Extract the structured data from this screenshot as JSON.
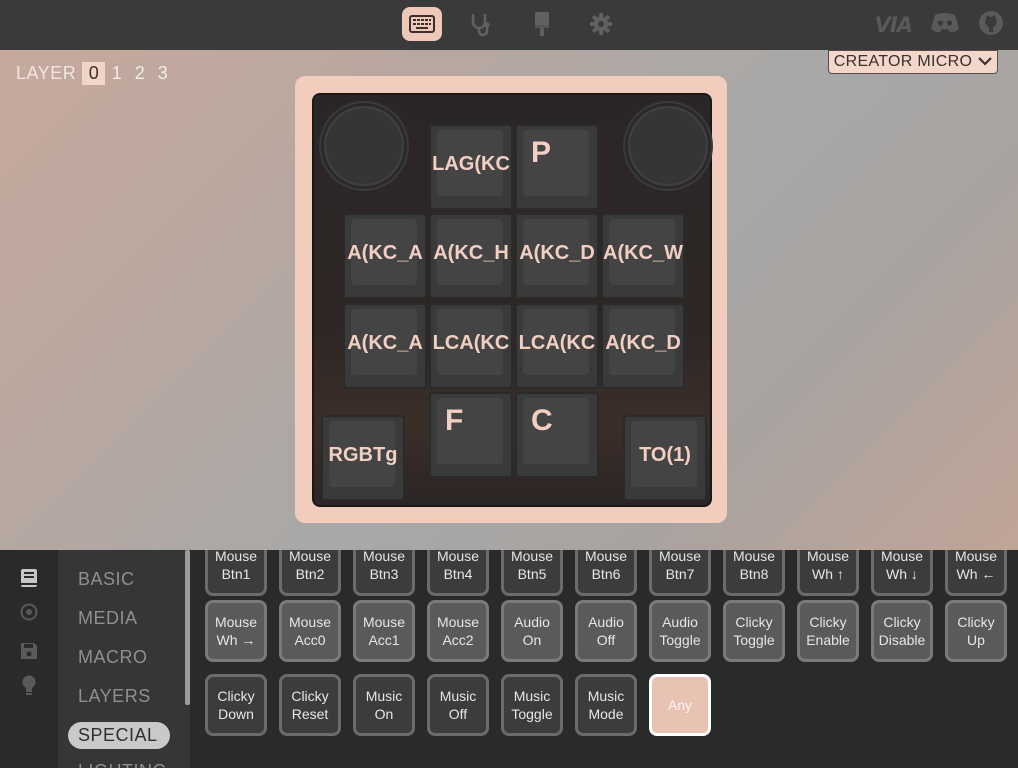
{
  "topbar": {
    "tabs": [
      {
        "name": "configure",
        "icon": "keyboard-icon",
        "active": true
      },
      {
        "name": "test",
        "icon": "stethoscope-icon",
        "active": false
      },
      {
        "name": "design",
        "icon": "brush-icon",
        "active": false
      },
      {
        "name": "settings",
        "icon": "gear-icon",
        "active": false
      }
    ],
    "logo_text": "VIA",
    "right_icons": [
      "discord-icon",
      "github-icon"
    ]
  },
  "layers": {
    "label": "LAYER",
    "items": [
      "0",
      "1",
      "2",
      "3"
    ],
    "active": "0"
  },
  "device": {
    "name": "CREATOR MICRO"
  },
  "keyboard": {
    "keys": [
      {
        "label": "LAG(KC"
      },
      {
        "label": "P"
      },
      {
        "label": "A(KC_A"
      },
      {
        "label": "A(KC_H"
      },
      {
        "label": "A(KC_D"
      },
      {
        "label": "A(KC_W"
      },
      {
        "label": "A(KC_A"
      },
      {
        "label": "LCA(KC"
      },
      {
        "label": "LCA(KC"
      },
      {
        "label": "A(KC_D"
      },
      {
        "label": "RGBTg"
      },
      {
        "label": "F"
      },
      {
        "label": "C"
      },
      {
        "label": "TO(1)"
      }
    ]
  },
  "sidebar": {
    "icons": [
      "book-icon",
      "record-icon",
      "save-icon",
      "lightbulb-icon"
    ]
  },
  "categories": {
    "items": [
      "BASIC",
      "MEDIA",
      "MACRO",
      "LAYERS",
      "SPECIAL",
      "LIGHTING"
    ],
    "active": "SPECIAL"
  },
  "keycodes": {
    "row1": [
      [
        "Mouse",
        "Btn1"
      ],
      [
        "Mouse",
        "Btn2"
      ],
      [
        "Mouse",
        "Btn3"
      ],
      [
        "Mouse",
        "Btn4"
      ],
      [
        "Mouse",
        "Btn5"
      ],
      [
        "Mouse",
        "Btn6"
      ],
      [
        "Mouse",
        "Btn7"
      ],
      [
        "Mouse",
        "Btn8"
      ],
      [
        "Mouse",
        "Wh ↑"
      ],
      [
        "Mouse",
        "Wh ↓"
      ],
      [
        "Mouse",
        "Wh ←"
      ]
    ],
    "row2": [
      [
        "Mouse",
        "Wh →"
      ],
      [
        "Mouse",
        "Acc0"
      ],
      [
        "Mouse",
        "Acc1"
      ],
      [
        "Mouse",
        "Acc2"
      ],
      [
        "Audio",
        "On"
      ],
      [
        "Audio",
        "Off"
      ],
      [
        "Audio",
        "Toggle"
      ],
      [
        "Clicky",
        "Toggle"
      ],
      [
        "Clicky",
        "Enable"
      ],
      [
        "Clicky",
        "Disable"
      ],
      [
        "Clicky",
        "Up"
      ]
    ],
    "row3": [
      [
        "Clicky",
        "Down"
      ],
      [
        "Clicky",
        "Reset"
      ],
      [
        "Music",
        "On"
      ],
      [
        "Music",
        "Off"
      ],
      [
        "Music",
        "Toggle"
      ],
      [
        "Music",
        "Mode"
      ],
      [
        "Any",
        ""
      ]
    ]
  }
}
